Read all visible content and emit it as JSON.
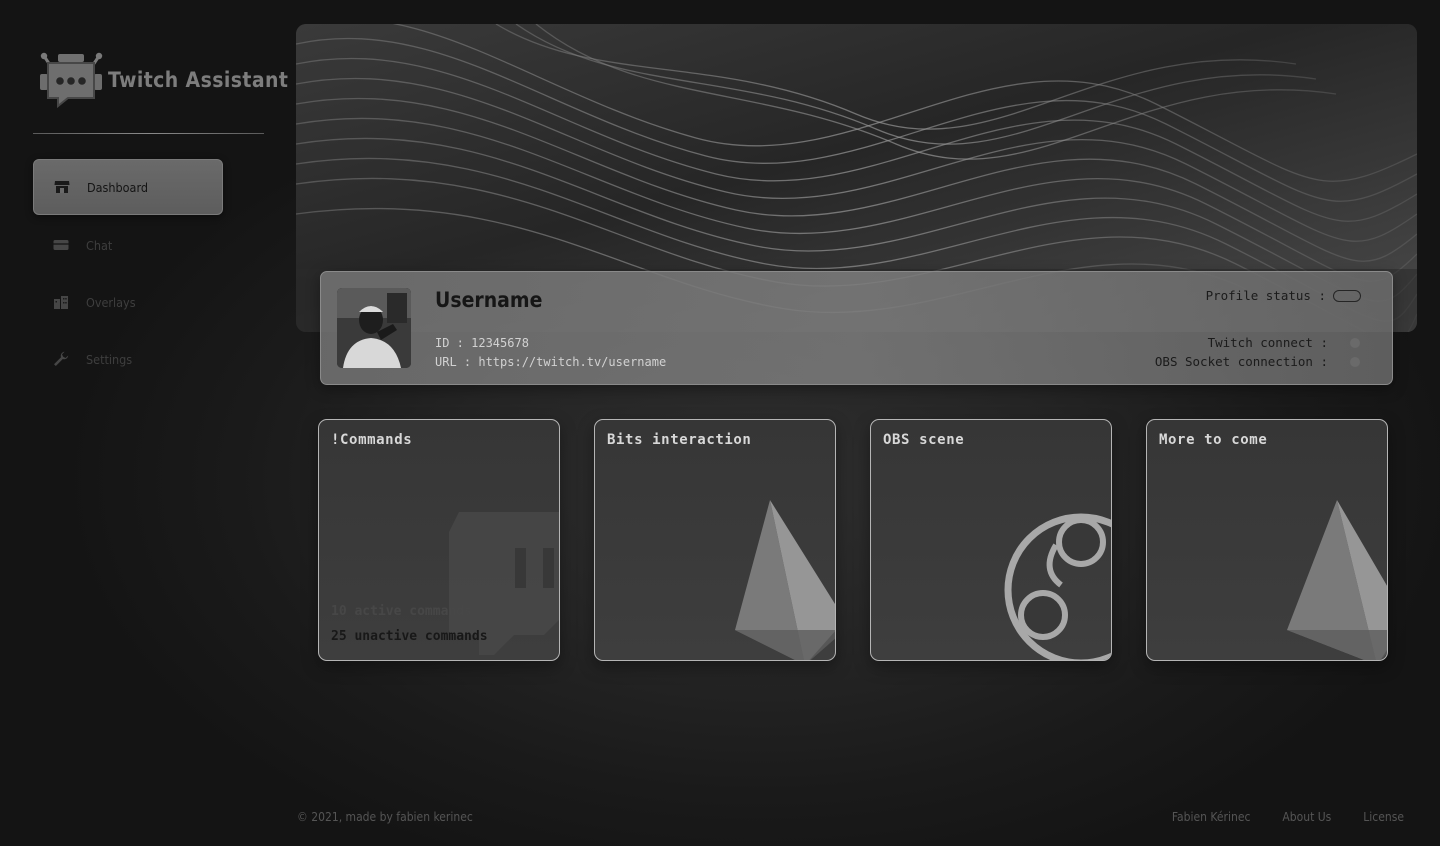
{
  "brand": {
    "name": "Twitch Assistant",
    "logo_icon": "robot-chat-icon"
  },
  "sidebar": {
    "items": [
      {
        "label": "Dashboard",
        "icon": "store-icon",
        "active": true
      },
      {
        "label": "Chat",
        "icon": "card-icon",
        "active": false
      },
      {
        "label": "Overlays",
        "icon": "building-icon",
        "active": false
      },
      {
        "label": "Settings",
        "icon": "wrench-icon",
        "active": false
      }
    ]
  },
  "profile": {
    "username": "Username",
    "id_label": "ID : 12345678",
    "url_label": "URL : https://twitch.tv/username",
    "status_label": "Profile status :",
    "twitch_label": "Twitch connect :",
    "obs_label": "OBS Socket connection :"
  },
  "cards": {
    "commands": {
      "title": "!Commands",
      "active_text": "10 active commands",
      "inactive_text": "25 unactive commands",
      "icon": "twitch-glitch-icon"
    },
    "bits": {
      "title": "Bits interaction",
      "icon": "bits-gem-icon"
    },
    "obs": {
      "title": "OBS scene",
      "icon": "obs-logo-icon"
    },
    "more": {
      "title": "More to come",
      "icon": "bits-gem-icon"
    }
  },
  "footer": {
    "copyright": "© 2021, made by fabien kerinec",
    "links": [
      "Fabien Kérinec",
      "About Us",
      "License"
    ]
  },
  "colors": {
    "background": "#161616",
    "active_nav": "#636363",
    "card_border": "#b5b5b5"
  }
}
